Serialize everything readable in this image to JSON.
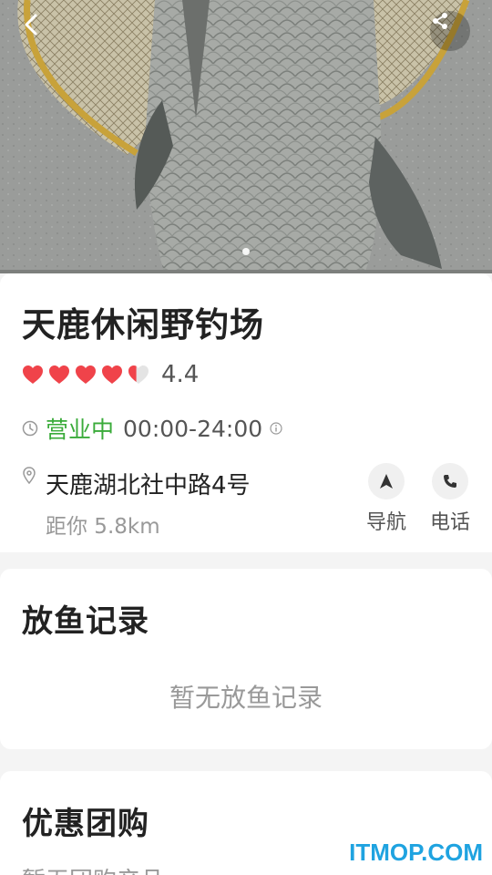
{
  "hero": {
    "back_icon": "chevron-left-icon",
    "share_icon": "share-icon",
    "page_count": 1,
    "current_page": 1
  },
  "shop": {
    "name": "天鹿休闲野钓场",
    "rating": "4.4",
    "rating_stars": 4.4,
    "rating_max": 5,
    "heart_color": "#f0434a",
    "status": "营业中",
    "status_color": "#3aab3a",
    "hours": "00:00-24:00",
    "address": "天鹿湖北社中路4号",
    "distance": "距你 5.8km"
  },
  "actions": {
    "navigate_label": "导航",
    "call_label": "电话"
  },
  "records": {
    "title": "放鱼记录",
    "empty": "暂无放鱼记录"
  },
  "group_buy": {
    "title": "优惠团购",
    "empty": "暂无团购产品"
  },
  "watermark": "ITMOP.COM"
}
